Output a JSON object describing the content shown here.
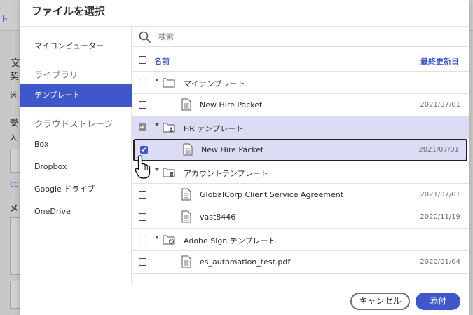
{
  "background": {
    "top_link": "ト",
    "chars": [
      "文",
      "契",
      "送",
      "受",
      "入",
      "CC",
      "メ"
    ]
  },
  "dialog": {
    "title": "ファイルを選択"
  },
  "nav": {
    "my_computer": "マイコンピューター",
    "library_heading": "ライブラリ",
    "templates": "テンプレート",
    "cloud_heading": "クラウドストレージ",
    "box": "Box",
    "dropbox": "Dropbox",
    "google_drive": "Google ドライブ",
    "onedrive": "OneDrive"
  },
  "search": {
    "placeholder": "検索"
  },
  "table": {
    "col_name": "名前",
    "col_date": "最終更新日",
    "rows": [
      {
        "type": "folder",
        "name": "マイテンプレート",
        "date": ""
      },
      {
        "type": "file",
        "name": "New Hire Packet",
        "date": "2021/07/01"
      },
      {
        "type": "folder",
        "name": "HR テンプレート",
        "date": ""
      },
      {
        "type": "file",
        "name": "New Hire Packet",
        "date": "2021/07/01"
      },
      {
        "type": "folder",
        "name": "アカウントテンプレート",
        "date": ""
      },
      {
        "type": "file",
        "name": "GlobalCorp Client Service Agreement",
        "date": "2021/07/01"
      },
      {
        "type": "file",
        "name": "vast8446",
        "date": "2020/11/19"
      },
      {
        "type": "folder",
        "name": "Adobe Sign テンプレート",
        "date": ""
      },
      {
        "type": "file",
        "name": "es_automation_test.pdf",
        "date": "2020/01/04"
      }
    ]
  },
  "footer": {
    "cancel": "キャンセル",
    "attach": "添付"
  },
  "colors": {
    "accent": "#3f57c8",
    "selected_row": "#dcdcf5"
  }
}
